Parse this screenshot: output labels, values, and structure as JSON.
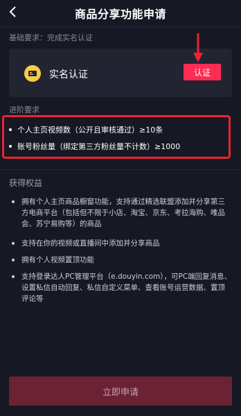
{
  "header": {
    "title": "商品分享功能申请",
    "back_icon": "chevron-left-icon"
  },
  "basic": {
    "label": "基础要求：完成实名认证",
    "verify_label": "实名认证",
    "verify_button": "认证",
    "id_icon": "id-card-icon"
  },
  "advanced": {
    "label": "进阶要求",
    "items": [
      {
        "text": "个人主页视频数（公开且审核通过）≥10条"
      },
      {
        "text": "账号粉丝量（绑定第三方粉丝量不计数）≥1000"
      }
    ]
  },
  "rights": {
    "label": "获得权益",
    "items": [
      {
        "text": "拥有个人主页商品橱窗功能，支持通过精选联盟添加并分享第三方电商平台（包括但不限于小店、淘宝、京东、考拉海购、唯品会、苏宁易购等）的商品"
      },
      {
        "text": "支持在你的视频或直播间中添加并分享商品"
      },
      {
        "text": "拥有个人视频置顶功能"
      },
      {
        "text": "支持登录达人PC管理平台（e.douyin.com），可PC端回复消息、设置私信自动回复、私信自定义菜单、查看账号运营数据、置顶评论等"
      }
    ]
  },
  "footer": {
    "apply_button": "立即申请"
  },
  "colors": {
    "background": "#161823",
    "accent": "#fe2c55",
    "highlight_box": "#ee2233"
  }
}
